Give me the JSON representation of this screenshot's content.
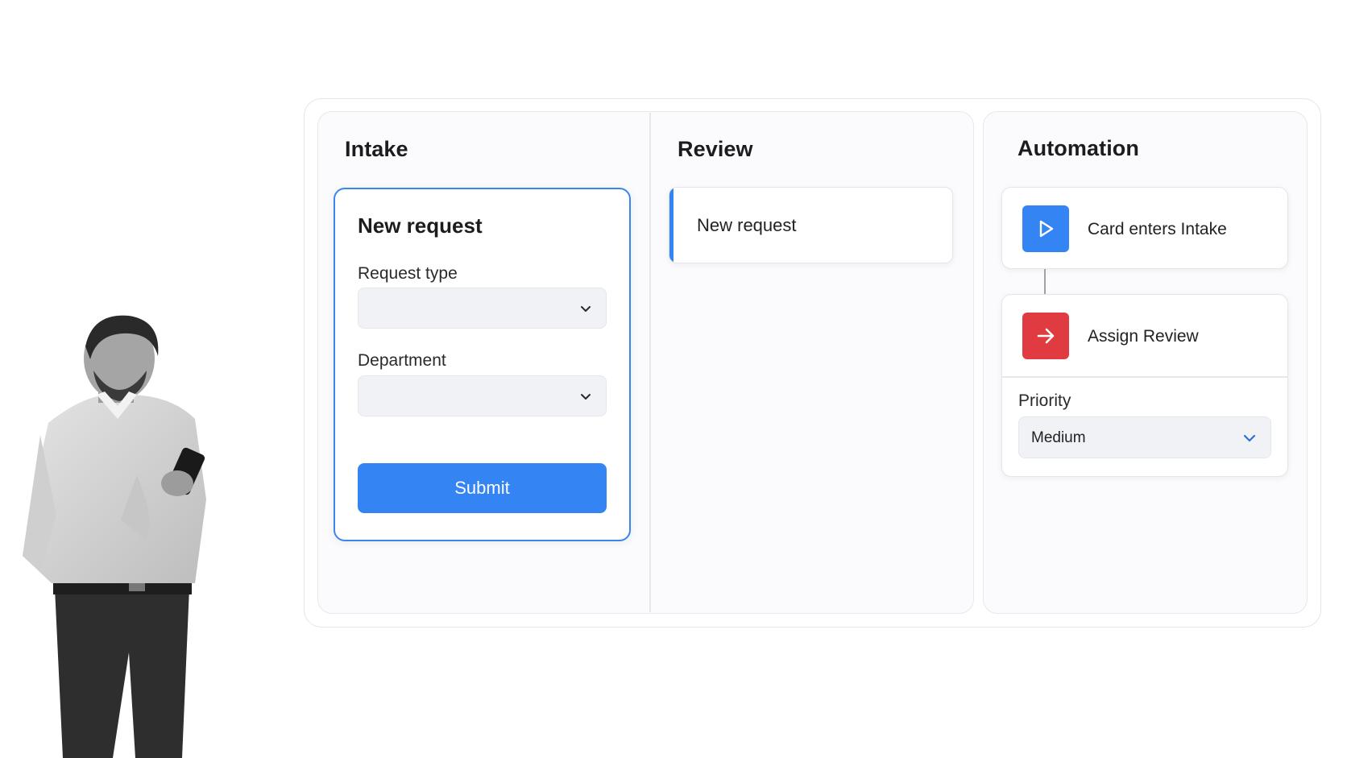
{
  "columns": {
    "intake": {
      "title": "Intake"
    },
    "review": {
      "title": "Review"
    },
    "automation": {
      "title": "Automation"
    }
  },
  "intake_form": {
    "title": "New request",
    "request_type": {
      "label": "Request type",
      "value": ""
    },
    "department": {
      "label": "Department",
      "value": ""
    },
    "submit_label": "Submit"
  },
  "review_card": {
    "label": "New request"
  },
  "automation": {
    "trigger": {
      "label": "Card enters Intake",
      "icon": "play-icon"
    },
    "action": {
      "label": "Assign Review",
      "icon": "arrow-right-icon"
    },
    "priority": {
      "label": "Priority",
      "value": "Medium"
    }
  },
  "colors": {
    "accent_blue": "#3485f3",
    "action_red": "#df3b40"
  }
}
